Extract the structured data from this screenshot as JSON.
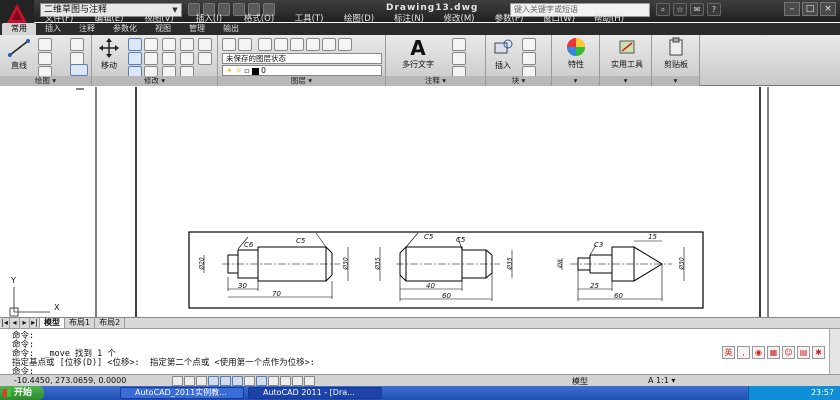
{
  "app": {
    "workspace": "二维草图与注释",
    "document_title": "Drawing13.dwg",
    "search_placeholder": "键入关键字或短语"
  },
  "menus": [
    "文件(F)",
    "编辑(E)",
    "视图(V)",
    "插入(I)",
    "格式(O)",
    "工具(T)",
    "绘图(D)",
    "标注(N)",
    "修改(M)",
    "参数(P)",
    "窗口(W)",
    "帮助(H)"
  ],
  "ribbon_tabs": [
    "常用",
    "插入",
    "注释",
    "参数化",
    "视图",
    "管理",
    "输出"
  ],
  "panels": {
    "draw": {
      "label": "绘图 ▾",
      "line": "直线"
    },
    "modify": {
      "label": "修改 ▾",
      "move": "移动"
    },
    "layers": {
      "label": "图层 ▾",
      "layer_state": "未保存的图层状态",
      "layer_name": "0"
    },
    "annotation": {
      "label": "注释 ▾",
      "mtext": "多行文字"
    },
    "block": {
      "label": "块 ▾",
      "insert": "插入"
    },
    "properties": {
      "label": "特性"
    },
    "utilities": {
      "label": "实用工具"
    },
    "clipboard": {
      "label": "剪贴板"
    }
  },
  "layout_tabs": [
    "模型",
    "布局1",
    "布局2"
  ],
  "command_lines": [
    "命令:",
    "命令:",
    "命令:  _move 找到 1 个",
    "指定基点或 [位移(D)] <位移>:  指定第二个点或 <使用第一个点作为位移>:",
    "命令:"
  ],
  "ime_label": "英",
  "status": {
    "coords": "-10.4450, 273.0659, 0.0000",
    "model": "模型",
    "scale": "A 1:1 ▾"
  },
  "taskbar": {
    "start": "开始",
    "items": [
      "AutoCAD_2011实例教...",
      "AutoCAD 2011 - [Dra..."
    ],
    "clock": "23:57"
  },
  "drawing": {
    "part1": {
      "dims": [
        "C6",
        "C5",
        "Ø20",
        "Ø30",
        "30",
        "70"
      ]
    },
    "part2": {
      "dims": [
        "C5",
        "C5",
        "Ø35",
        "Ø35",
        "40",
        "60"
      ]
    },
    "part3": {
      "dims": [
        "C3",
        "15",
        "Ø8",
        "Ø30",
        "25",
        "60"
      ]
    },
    "ucs": {
      "y": "Y",
      "x": "X"
    }
  },
  "colors": {
    "accent_red": "#c8102e",
    "ribbon": "#d6d6d6",
    "taskbar": "#245edb"
  }
}
